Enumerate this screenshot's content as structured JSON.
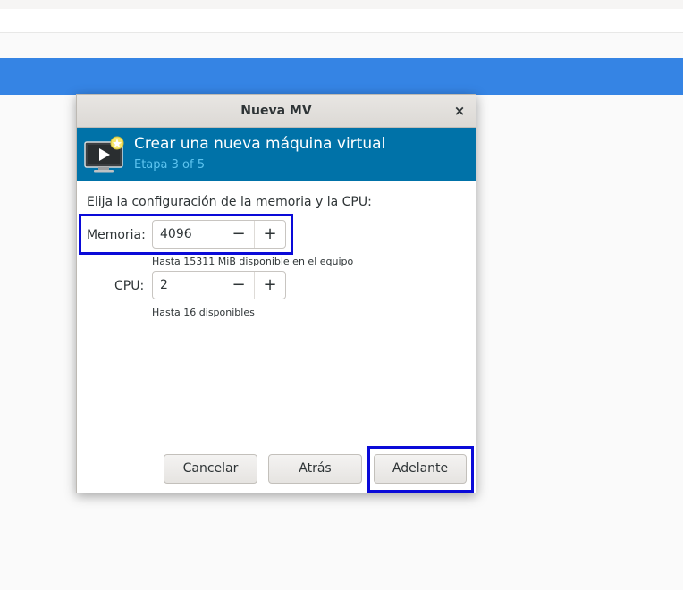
{
  "dialog": {
    "title": "Nueva MV",
    "close_glyph": "×"
  },
  "header": {
    "title": "Crear una nueva máquina virtual",
    "step": "Etapa 3 of 5",
    "icon": "vm-monitor-icon"
  },
  "content": {
    "prompt": "Elija la configuración de la memoria y la CPU:",
    "memory": {
      "label": "Memoria:",
      "value": "4096",
      "minus": "−",
      "plus": "+",
      "hint": "Hasta 15311 MiB disponible en el equipo"
    },
    "cpu": {
      "label": "CPU:",
      "value": "2",
      "minus": "−",
      "plus": "+",
      "hint": "Hasta 16 disponibles"
    }
  },
  "buttons": {
    "cancel": "Cancelar",
    "back": "Atrás",
    "forward": "Adelante"
  },
  "colors": {
    "header_band": "#0072a8",
    "accent_band": "#3584e4",
    "highlight": "#0a0ad8"
  }
}
